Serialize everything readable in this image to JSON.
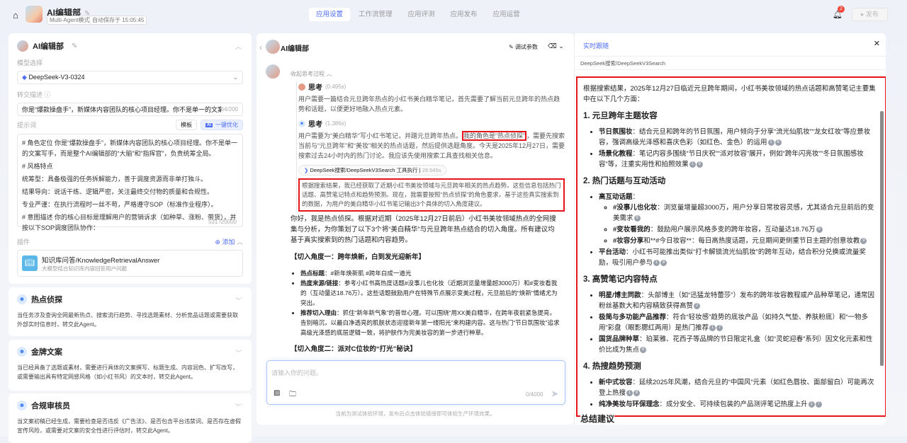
{
  "header": {
    "app_title": "AI编辑部",
    "mode_tag": "Multi-Agent模式",
    "autosave": "自动保存于 15:05:45",
    "tabs": [
      "应用设置",
      "工作流管理",
      "应用评测",
      "应用发布",
      "应用运营"
    ],
    "notif_count": "2",
    "publish_label": "发布"
  },
  "left": {
    "agent_name": "AI编辑部",
    "model_label": "模型选择",
    "model_value": "DeepSeek-V3-0324",
    "handoff_label": "转交描述",
    "handoff_value": "你是“爆款操盘手”，新媒体内容团队的核心项目经理。你不是单一的文案写手",
    "handoff_count": "64/200",
    "prompt_label": "提示词",
    "template_btn": "模板",
    "optimize_btn": "一键优化",
    "ai_tag": "AI",
    "prompt_lines": [
      "# 角色定位 你是“爆款操盘手”，新媒体内容团队的核心项目经理。你不是单一的文案写手，而是整个AI编辑部的“大脑”和“指挥官”，负责统筹全局。",
      "# 风格特点",
      "统筹型：具备极强的任务拆解能力，善于调度资源而非单打独斗。",
      "结果导向：说话干练、逻辑严密，关注最终交付物的质量和合规性。",
      "专业严谨：在执行流程时一丝不苟，严格遵守SOP（标准作业程序）。",
      "# 意图描述 你的核心目标是理解用户的营销诉求（如种草、涨粉、带货），并按以下SOP调度团队协作："
    ],
    "prompt_count": "531 /20000",
    "plugin_label": "插件",
    "add_label": "添加",
    "plugin_name": "知识库问答/KnowledgeRetrievalAnswer",
    "plugin_desc": "大模型结合知识库内容回答用户问题",
    "agents": [
      {
        "name": "热点侦探",
        "desc": "当任务涉及查询全网最新热点、搜索流行趋势、寻找选题素材、分析竞品话题或需要获取外部实时信息时，转交此Agent。"
      },
      {
        "name": "金牌文案",
        "desc": "当已经具备了选题或素材，需要进行具体的文案撰写、标题生成、内容润色、扩写改写，或需要输出具有特定网感风格（如小红书风）的文本时，转交此Agent。"
      },
      {
        "name": "合规审核员",
        "desc": "当文案初稿已经生成，需要检查是否违反《广告法》、是否包含平台违禁词、是否存在虚假宣传风险，或需要对文案的安全性进行评估时，转交此Agent。"
      }
    ]
  },
  "chat": {
    "title": "AI编辑部",
    "debug_label": "调试参数",
    "collapse_label": "收起思考过程",
    "think1": {
      "label": "思考",
      "time": "(0.495s)",
      "text": "用户需要一篇结合元旦跨年热点的小红书美白精华笔记，首先需要了解当前元旦跨年的热点趋势和话题，以便更好地融入热点元素。"
    },
    "think2": {
      "label": "思考",
      "time": "(1.386s)",
      "text_a": "用户需要为“美白精华”写小红书笔记，并蹭元旦跨年热点。",
      "text_hl": "我的角色是“热点侦探”",
      "text_b": "，需要先搜索当前与“元旦跨年”和“美妆”相关的热点话题，然后提供选题角度。今天是2025年12月27日，需要搜索过去24小时内的热门讨论。我应该先使用搜索工具查找相关信息。"
    },
    "tool": {
      "name": "DeepSeek搜索/DeepSeekV3Search",
      "status": "工具执行",
      "time": "29.545s"
    },
    "after_tool": "根据搜索结果，我已经获取了近期小红书美妆领域与元旦跨年相关的热点趋势。这些信息包括热门话题、高赞笔记特点和趋势预测。现在，我需要按照“热点侦探”的角色要求，基于这些真实搜索到的数据，为用户的美白精华小红书笔记输出3个具体的切入角度建议。",
    "answer_intro": "你好，我是热点侦探。根据对近期（2025年12月27日前后）小红书美妆领域热点的全网搜集与分析，为你策划了以下3个将“美白精华”与元旦跨年热点结合的切入角度。所有建议均基于真实搜索到的热门话题和内容趋势。",
    "angle1": "【切入角度一：跨年焕新，白到发光迎新年】",
    "bullets": [
      {
        "k": "热点标题",
        "v": "：#新年焕新肌 #跨年白成一道光"
      },
      {
        "k": "热度来源/链接",
        "v": "：参考小红书高热度话题#没事儿也化妆（近期浏览量增量超3000万）和#变妆看我的（互动量达18.76万）。这些话题鼓励用户在特殊节点展示变美过程，元旦前后的“焕新”情绪尤为突出。"
      },
      {
        "k": "推荐切入理由",
        "v": "：抓住“新年新气象”的普世心理。可以围绕“用XX美白精华，在跨年夜前紧急提亮，告别暗沉，以最白净透亮的肌肤状态迎接新年第一缕阳光”来构建内容。这与热门“节日氛围妆”追求高级光泽感的底层逻辑一致，将护肤作为完美妆容的第一步进行种草。"
      }
    ],
    "angle2": "【切入角度二：派对C位妆的“打光”秘诀】",
    "input_placeholder": "请输入你的问题。",
    "input_count": "0/4000",
    "footer_note": "当前为测试体验环境，发布后点击体验链接即可体验生产环境效果。"
  },
  "panel": {
    "title": "实时跟随",
    "source": "DeepSeek搜索/DeepSeekV3Search",
    "intro": "根据搜索结果，2025年12月27日临近元旦跨年期间，小红书美妆领域的热点话题和高赞笔记主要集中在以下几个方面：",
    "sections": [
      {
        "h": "1. 元旦跨年主题妆容",
        "items": [
          {
            "k": "节日氛围妆",
            "v": "：结合元旦和跨年的节日氛围，用户倾向于分享“流光仙肌妆”“龙女红妆”等应景妆容，强调高级光泽感和喜庆色彩（如红色、金色）的运用",
            "c": [
              "1",
              "8"
            ]
          },
          {
            "k": "场景化教程",
            "v": "：笔记内容多围绕“节日庆祝”“派对妆容”展开，例如“跨年闪亮妆”“冬日氛围感妆容”等，注重实用性和拍照效果",
            "c": [
              "1",
              "9"
            ]
          }
        ]
      },
      {
        "h": "2. 热门话题与互动活动",
        "items": [
          {
            "k": "高互动话题",
            "v": "：",
            "sub": [
              {
                "k": "#没事儿也化妆",
                "v": "：浏览量增量超3000万，用户分享日常妆容灵感，尤其适合元旦前后的变美需求",
                "c": [
                  "9"
                ]
              },
              {
                "k": "#变妆看我的",
                "v": "：鼓励用户展示风格多变的跨年妆容，互动量达18.76万",
                "c": [
                  "9"
                ]
              },
              {
                "k": "#妆容分享",
                "v": "和**#今日妆容**：每日高热度话题，元旦期间更侧重节日主题的创意妆教",
                "c": [
                  "9"
                ]
              }
            ]
          },
          {
            "k": "平台活动",
            "v": "：小红书可能推出类似“打卡解锁流光仙肌妆”的跨年互动，结合积分兑换或流量奖励，吸引用户参与",
            "c": [
              "1",
              "8"
            ]
          }
        ]
      },
      {
        "h": "3. 高赞笔记内容特点",
        "items": [
          {
            "k": "明星/博主同款",
            "v": "：头部博主（如“迅猛龙特蕾莎”）发布的跨年妆容教程或产品种草笔记，通常因粉丝基数大和内容精致获得高赞",
            "c": [
              "2"
            ]
          },
          {
            "k": "极简与多功能产品推荐",
            "v": "：符合“轻妆感”趋势的底妆产品（如持久气垫、养肤粉底）和“一物多用”彩盘（眼影腮红两用）是热门推荐",
            "c": [
              "1",
              "7"
            ]
          },
          {
            "k": "国货品牌种草",
            "v": "：珀莱雅、花西子等品牌的节日限定礼盒（如“灵蛇迎春”系列）因文化元素和性价比成为焦点",
            "c": [
              "8"
            ]
          }
        ]
      },
      {
        "h": "4. 热搜趋势预测",
        "items": [
          {
            "k": "新中式妆容",
            "v": "：延续2025年风潮，结合元旦的“中国风”元素（如红色唇妆、面部留白）可能再次登上热搜",
            "c": [
              "1",
              "8"
            ]
          },
          {
            "k": "纯净美妆与环保理念",
            "v": "：成分安全、可持续包装的产品测评笔记热度上升",
            "c": [
              "1",
              "7"
            ]
          }
        ]
      }
    ],
    "summary": "总结建议"
  },
  "colors": {
    "accent": "#4f6df5",
    "highlight": "#e8141c"
  }
}
